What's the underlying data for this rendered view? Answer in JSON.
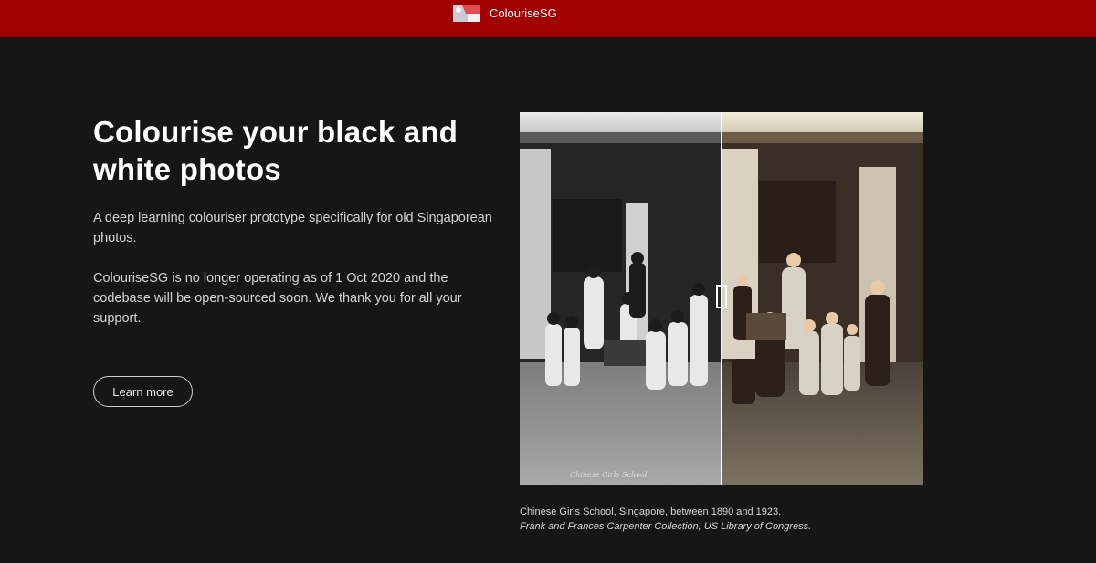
{
  "header": {
    "brand_name": "ColouriseSG",
    "logo_icon": "singapore-flag-icon",
    "background_color": "#a20000"
  },
  "hero": {
    "title": "Colourise your black and white photos",
    "description": "A deep learning colouriser prototype specifically for old Singaporean photos.",
    "notice": "ColouriseSG is no longer operating as of 1 Oct 2020 and the codebase will be open-sourced soon. We thank you for all your support.",
    "cta_label": "Learn more"
  },
  "comparison": {
    "left_label": "black-and-white original",
    "right_label": "colourised version",
    "split_fraction": 0.5,
    "photo_inscription": "Chinese Girls School"
  },
  "caption": {
    "line1": "Chinese Girls School, Singapore, between 1890 and 1923.",
    "line2": "Frank and Frances Carpenter Collection, US Library of Congress."
  },
  "colors": {
    "page_background": "#161616",
    "accent": "#a20000"
  }
}
